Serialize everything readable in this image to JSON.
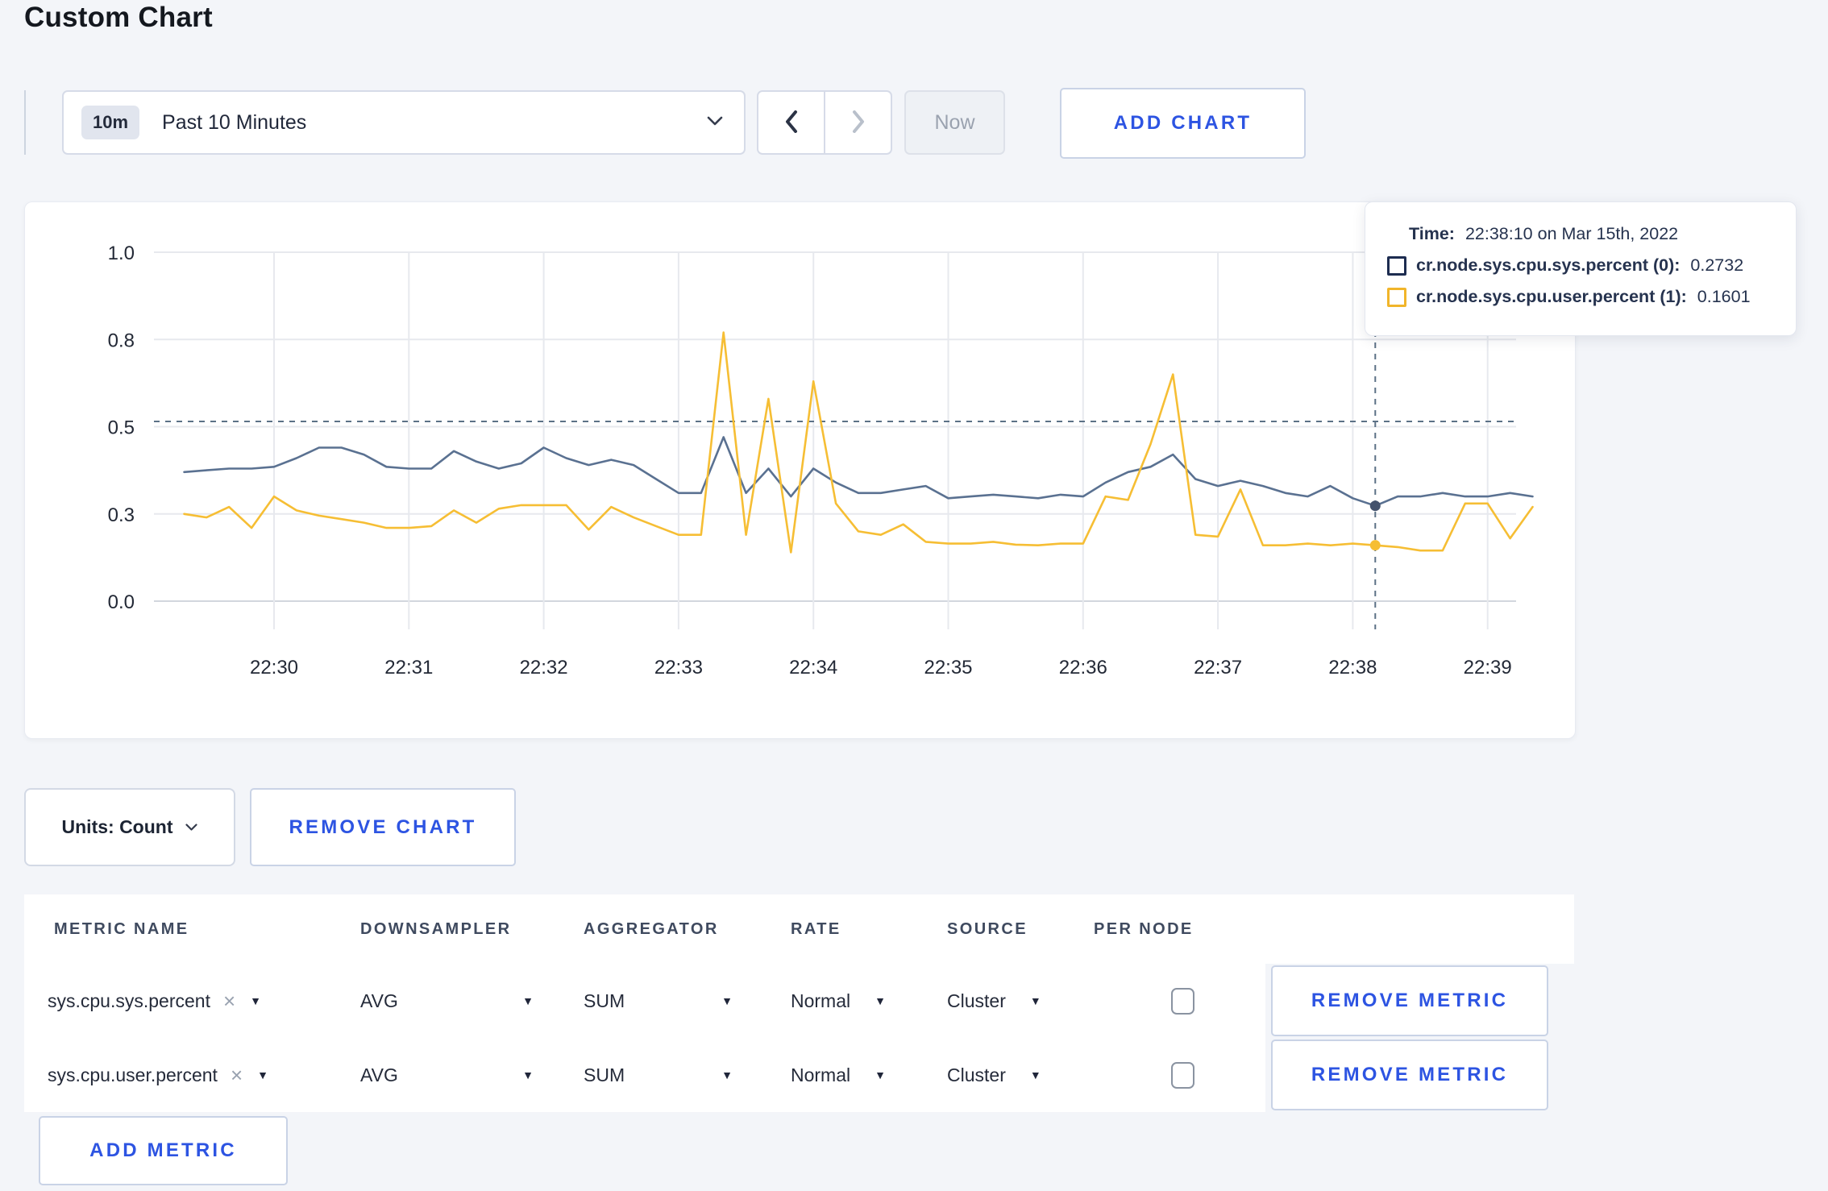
{
  "page": {
    "title": "Custom Chart",
    "background": "#f3f5f9",
    "accent_blue": "#2d54e2"
  },
  "toolbar": {
    "range_badge": "10m",
    "range_label": "Past 10 Minutes",
    "now_label": "Now",
    "add_chart_label": "ADD CHART"
  },
  "chart": {
    "tooltip": {
      "time_label": "Time:",
      "time_value": "22:38:10 on Mar 15th, 2022",
      "rows": [
        {
          "label": "cr.node.sys.cpu.sys.percent (0):",
          "value": "0.2732",
          "color": "#1d2c50"
        },
        {
          "label": "cr.node.sys.cpu.user.percent (1):",
          "value": "0.1601",
          "color": "#f1b52a"
        }
      ]
    }
  },
  "chart_data": {
    "type": "line",
    "title": "",
    "xlabel": "",
    "ylabel": "",
    "ylim": [
      0,
      1
    ],
    "grid": true,
    "x_start": "22:29:20",
    "x_step_seconds": 10,
    "x_ticks": [
      "22:30",
      "22:31",
      "22:32",
      "22:33",
      "22:34",
      "22:35",
      "22:36",
      "22:37",
      "22:38",
      "22:39"
    ],
    "y_ticks": [
      {
        "value": 0,
        "label": "0.0"
      },
      {
        "value": 0.25,
        "label": "0.3"
      },
      {
        "value": 0.5,
        "label": "0.5"
      },
      {
        "value": 0.75,
        "label": "0.8"
      },
      {
        "value": 1,
        "label": "1.0"
      }
    ],
    "series": [
      {
        "name": "cr.node.sys.cpu.sys.percent (0)",
        "color": "#5a7191",
        "values": [
          0.37,
          0.375,
          0.38,
          0.38,
          0.385,
          0.41,
          0.44,
          0.44,
          0.42,
          0.385,
          0.38,
          0.38,
          0.43,
          0.4,
          0.38,
          0.395,
          0.44,
          0.41,
          0.39,
          0.405,
          0.39,
          0.35,
          0.31,
          0.31,
          0.47,
          0.31,
          0.38,
          0.3,
          0.38,
          0.34,
          0.31,
          0.31,
          0.32,
          0.33,
          0.295,
          0.3,
          0.305,
          0.3,
          0.295,
          0.305,
          0.3,
          0.34,
          0.37,
          0.385,
          0.42,
          0.35,
          0.33,
          0.345,
          0.33,
          0.31,
          0.3,
          0.33,
          0.295,
          0.2732,
          0.3,
          0.3,
          0.31,
          0.3,
          0.3,
          0.31,
          0.3
        ]
      },
      {
        "name": "cr.node.sys.cpu.user.percent (1)",
        "color": "#f6be34",
        "values": [
          0.25,
          0.24,
          0.27,
          0.21,
          0.3,
          0.26,
          0.245,
          0.235,
          0.225,
          0.21,
          0.21,
          0.215,
          0.26,
          0.225,
          0.265,
          0.275,
          0.275,
          0.275,
          0.205,
          0.27,
          0.24,
          0.215,
          0.19,
          0.19,
          0.77,
          0.19,
          0.58,
          0.14,
          0.63,
          0.28,
          0.2,
          0.19,
          0.22,
          0.17,
          0.165,
          0.165,
          0.17,
          0.162,
          0.16,
          0.165,
          0.165,
          0.3,
          0.29,
          0.45,
          0.65,
          0.19,
          0.185,
          0.32,
          0.16,
          0.16,
          0.165,
          0.16,
          0.165,
          0.1601,
          0.155,
          0.145,
          0.145,
          0.28,
          0.28,
          0.18,
          0.27
        ]
      }
    ],
    "crosshair": {
      "time": "22:38:10",
      "x_index": 53,
      "hover_value_line": 0.515,
      "dot_values": [
        0.2732,
        0.1601
      ]
    },
    "legend_position": "tooltip-overlay"
  },
  "units": {
    "label": "Units: Count",
    "remove_chart_label": "REMOVE CHART"
  },
  "metrics_table": {
    "headers": [
      "METRIC NAME",
      "DOWNSAMPLER",
      "AGGREGATOR",
      "RATE",
      "SOURCE",
      "PER NODE"
    ],
    "controls": {
      "clear_glyph": "×",
      "caret_glyph": "▼"
    },
    "rows": [
      {
        "metric": "sys.cpu.sys.percent",
        "downsampler": "AVG",
        "aggregator": "SUM",
        "rate": "Normal",
        "source": "Cluster",
        "per_node_checked": false,
        "remove_label": "REMOVE METRIC"
      },
      {
        "metric": "sys.cpu.user.percent",
        "downsampler": "AVG",
        "aggregator": "SUM",
        "rate": "Normal",
        "source": "Cluster",
        "per_node_checked": false,
        "remove_label": "REMOVE METRIC"
      }
    ],
    "add_metric_label": "ADD METRIC"
  }
}
